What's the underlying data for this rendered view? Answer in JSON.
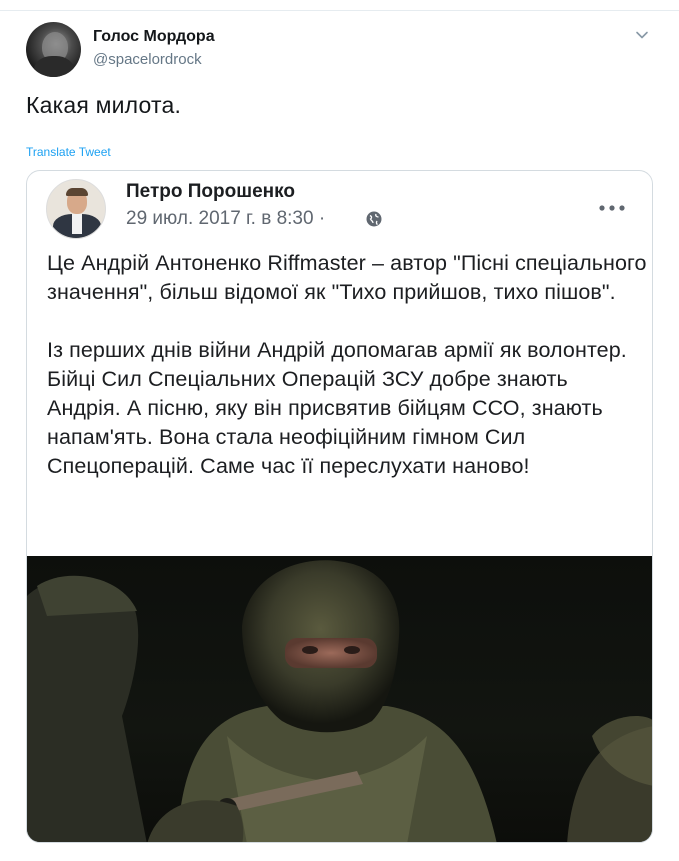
{
  "tweet": {
    "display_name": "Голос Мордора",
    "handle": "@spacelordrock",
    "text": "Какая милота.",
    "translate_label": "Translate Tweet",
    "menu_icon": "chevron-down-icon"
  },
  "embedded_post": {
    "author": "Петро Порошенко",
    "date": "29 июл. 2017 г. в 8:30",
    "separator": "·",
    "privacy_icon": "globe-icon",
    "more_icon": "more-horizontal-icon",
    "paragraph_1": "Це Андрій Антоненко  Riffmaster – автор \"Пісні спеціального значення\", більш відомої як \"Тихо прийшов, тихо пішов\".",
    "paragraph_2": "Із перших днів війни Андрій допомагав армії як волонтер. Бійці Сил Спеціальних Операцій ЗСУ добре знають Андрія. А пісню, яку він присвятив бійцям ССО, знають напам'ять. Вона стала неофіційним гімном Сил Спецоперацій. Саме час її переслухати наново!"
  },
  "colors": {
    "link_blue": "#1da1f2",
    "secondary_gray": "#657786",
    "fb_gray": "#606770",
    "border": "#d4dbe0"
  }
}
